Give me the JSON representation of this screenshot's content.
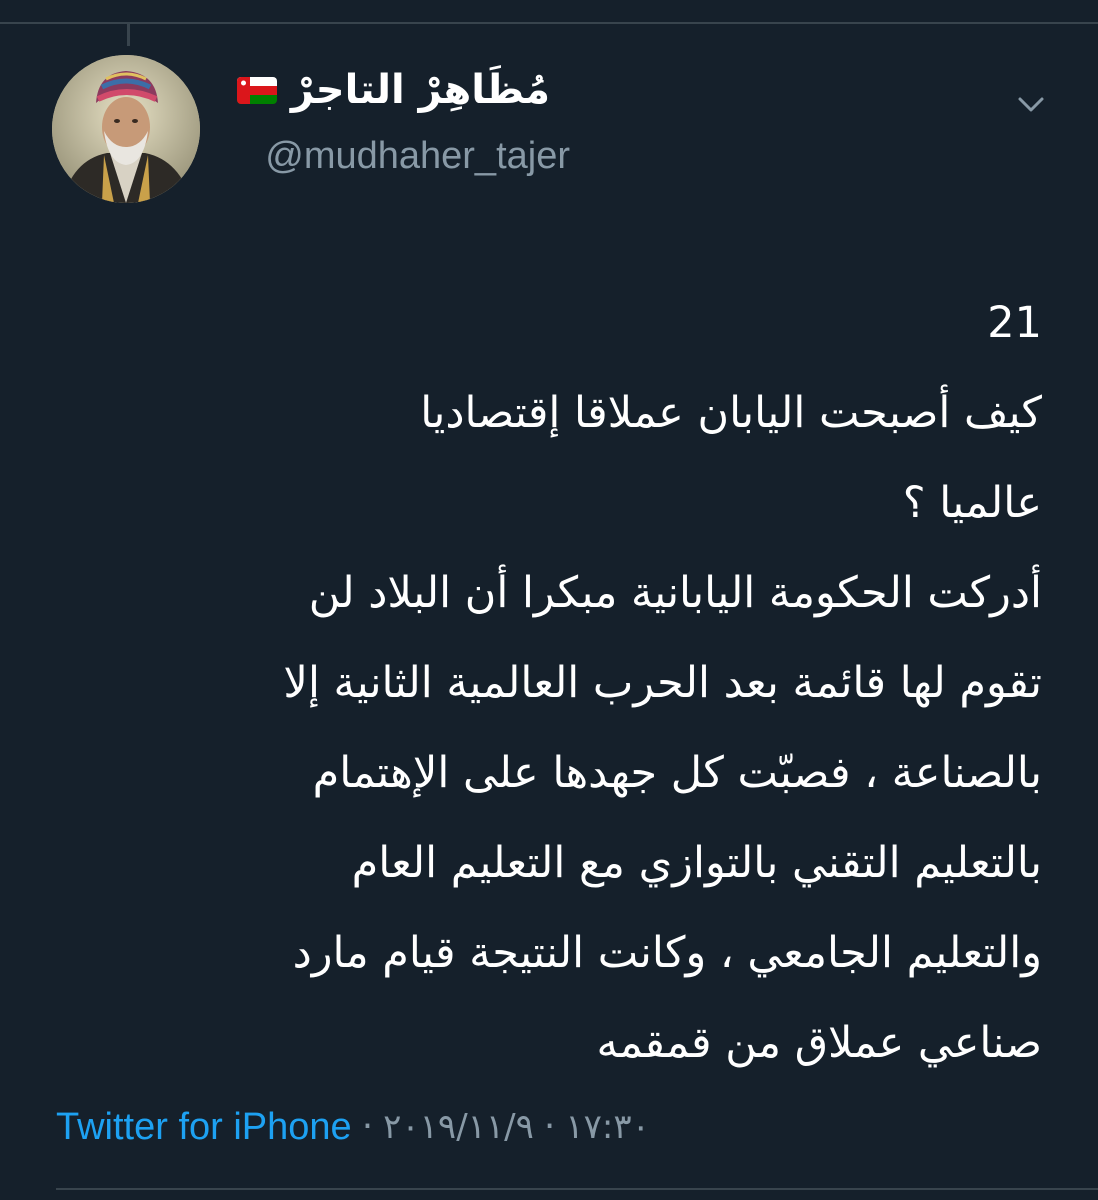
{
  "colors": {
    "background": "#15202b",
    "text": "#ffffff",
    "secondary_text": "#8899a6",
    "link": "#1da1f2",
    "divider": "#38444d"
  },
  "header": {
    "display_name": "مُظَاهِرْ التاجرْ",
    "flag_icon": "oman-flag-icon",
    "handle": "@mudhaher_tajer",
    "menu_icon": "chevron-down-icon"
  },
  "tweet": {
    "number": "21",
    "lines": [
      "كيف أصبحت اليابان عملاقا إقتصاديا",
      "عالميا ؟",
      "أدركت الحكومة اليابانية مبكرا أن البلاد لن",
      "تقوم لها قائمة بعد الحرب العالمية الثانية إلا",
      "بالصناعة ، فصبّت كل جهدها على الإهتمام",
      "بالتعليم التقني بالتوازي مع التعليم العام",
      "والتعليم الجامعي ، وكانت النتيجة قيام مارد",
      "صناعي عملاق من قمقمه"
    ]
  },
  "meta": {
    "source": "Twitter for iPhone",
    "separator": "·",
    "date": "٢٠١٩/١١/٩",
    "time": "١٧:٣٠"
  }
}
